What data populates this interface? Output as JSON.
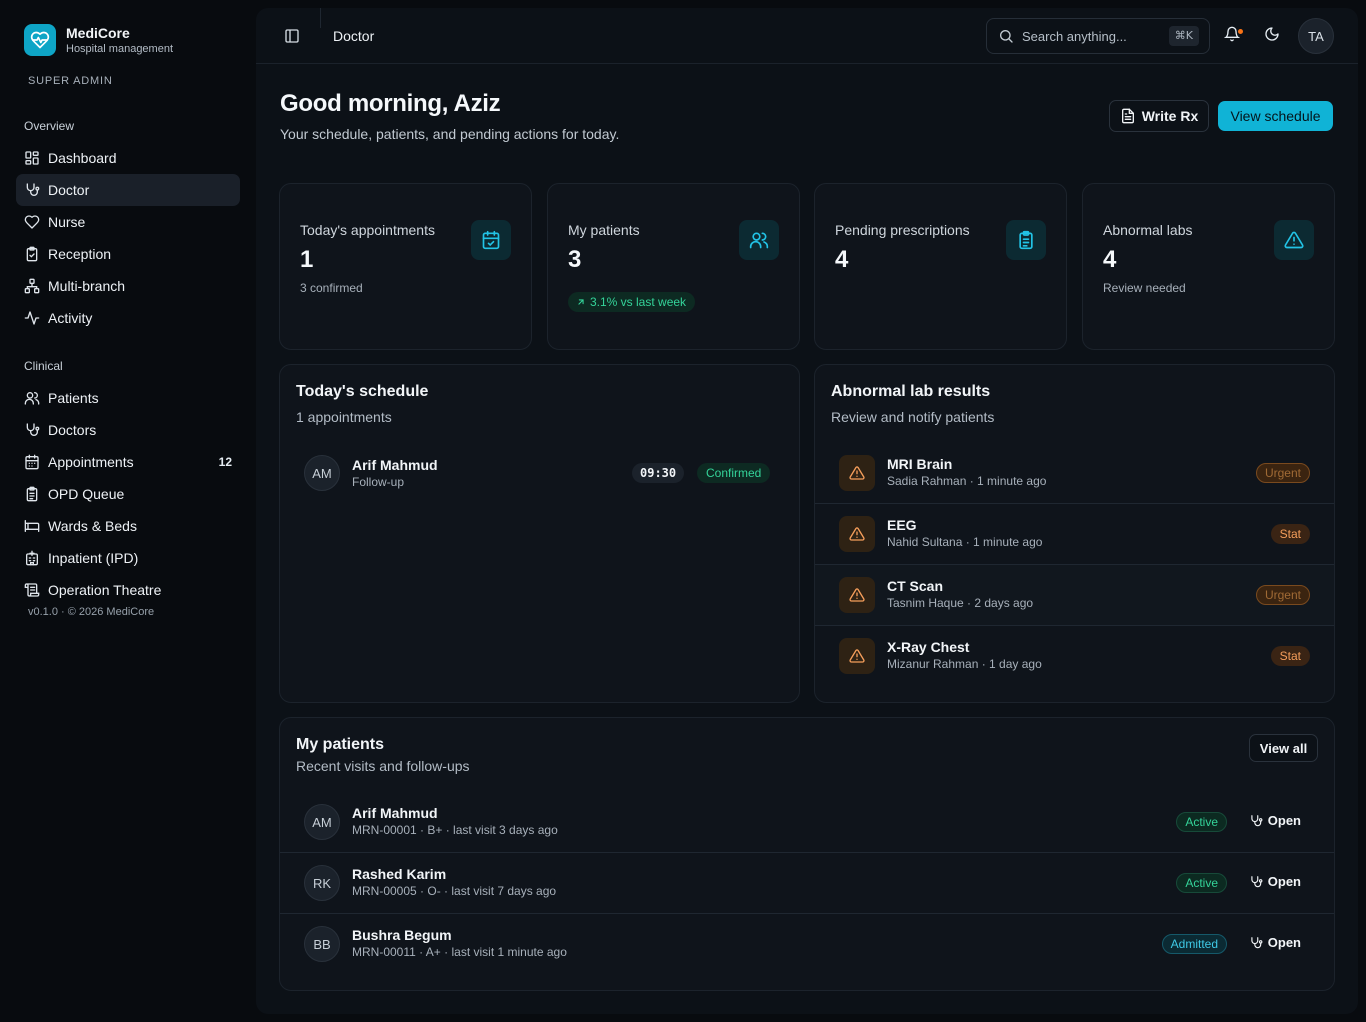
{
  "brand": {
    "name": "MediCore",
    "subtitle": "Hospital management"
  },
  "role": "SUPER ADMIN",
  "sidebar": {
    "overview_label": "Overview",
    "overview_items": [
      {
        "label": "Dashboard",
        "icon": "dashboard-icon"
      },
      {
        "label": "Doctor",
        "icon": "stethoscope-icon",
        "active": true
      },
      {
        "label": "Nurse",
        "icon": "heart-icon"
      },
      {
        "label": "Reception",
        "icon": "clipboard-check-icon"
      },
      {
        "label": "Multi-branch",
        "icon": "network-icon"
      },
      {
        "label": "Activity",
        "icon": "activity-icon"
      }
    ],
    "clinical_label": "Clinical",
    "clinical_items": [
      {
        "label": "Patients",
        "icon": "users-icon"
      },
      {
        "label": "Doctors",
        "icon": "stethoscope-icon"
      },
      {
        "label": "Appointments",
        "icon": "calendar-icon",
        "count": "12"
      },
      {
        "label": "OPD Queue",
        "icon": "clipboard-list-icon"
      },
      {
        "label": "Wards & Beds",
        "icon": "bed-icon"
      },
      {
        "label": "Inpatient (IPD)",
        "icon": "hospital-icon"
      },
      {
        "label": "Operation Theatre",
        "icon": "scroll-icon"
      }
    ],
    "footer": "v0.1.0 · © 2026 MediCore"
  },
  "topbar": {
    "title": "Doctor",
    "search_placeholder": "Search anything...",
    "search_shortcut": "⌘K",
    "user_initials": "TA"
  },
  "header": {
    "greeting": "Good morning, Aziz",
    "subtitle": "Your schedule, patients, and pending actions for today.",
    "write_rx_label": "Write Rx",
    "view_schedule_label": "View schedule"
  },
  "stats": [
    {
      "label": "Today's appointments",
      "value": "1",
      "sub": "3 confirmed",
      "icon": "calendar-check-icon"
    },
    {
      "label": "My patients",
      "value": "3",
      "trend": "3.1% vs last week",
      "icon": "users-icon"
    },
    {
      "label": "Pending prescriptions",
      "value": "4",
      "icon": "clipboard-list-icon"
    },
    {
      "label": "Abnormal labs",
      "value": "4",
      "sub": "Review needed",
      "icon": "alert-triangle-icon"
    }
  ],
  "schedule": {
    "title": "Today's schedule",
    "subtitle": "1 appointments",
    "items": [
      {
        "initials": "AM",
        "name": "Arif Mahmud",
        "type": "Follow-up",
        "time": "09:30",
        "status": "Confirmed"
      }
    ]
  },
  "labs": {
    "title": "Abnormal lab results",
    "subtitle": "Review and notify patients",
    "items": [
      {
        "test": "MRI Brain",
        "meta": "Sadia Rahman · 1 minute ago",
        "priority": "Urgent"
      },
      {
        "test": "EEG",
        "meta": "Nahid Sultana · 1 minute ago",
        "priority": "Stat"
      },
      {
        "test": "CT Scan",
        "meta": "Tasnim Haque · 2 days ago",
        "priority": "Urgent"
      },
      {
        "test": "X-Ray Chest",
        "meta": "Mizanur Rahman · 1 day ago",
        "priority": "Stat"
      }
    ]
  },
  "patients": {
    "title": "My patients",
    "subtitle": "Recent visits and follow-ups",
    "view_all_label": "View all",
    "open_label": "Open",
    "items": [
      {
        "initials": "AM",
        "name": "Arif Mahmud",
        "meta": "MRN-00001 · B+ · last visit 3 days ago",
        "status": "Active"
      },
      {
        "initials": "RK",
        "name": "Rashed Karim",
        "meta": "MRN-00005 · O- · last visit 7 days ago",
        "status": "Active"
      },
      {
        "initials": "BB",
        "name": "Bushra Begum",
        "meta": "MRN-00011 · A+ · last visit 1 minute ago",
        "status": "Admitted"
      }
    ]
  },
  "colors": {
    "accent": "#10b3d6",
    "success": "#34d399",
    "warning": "#f59e5b",
    "background": "#080b0f",
    "panel": "#0c1117"
  }
}
